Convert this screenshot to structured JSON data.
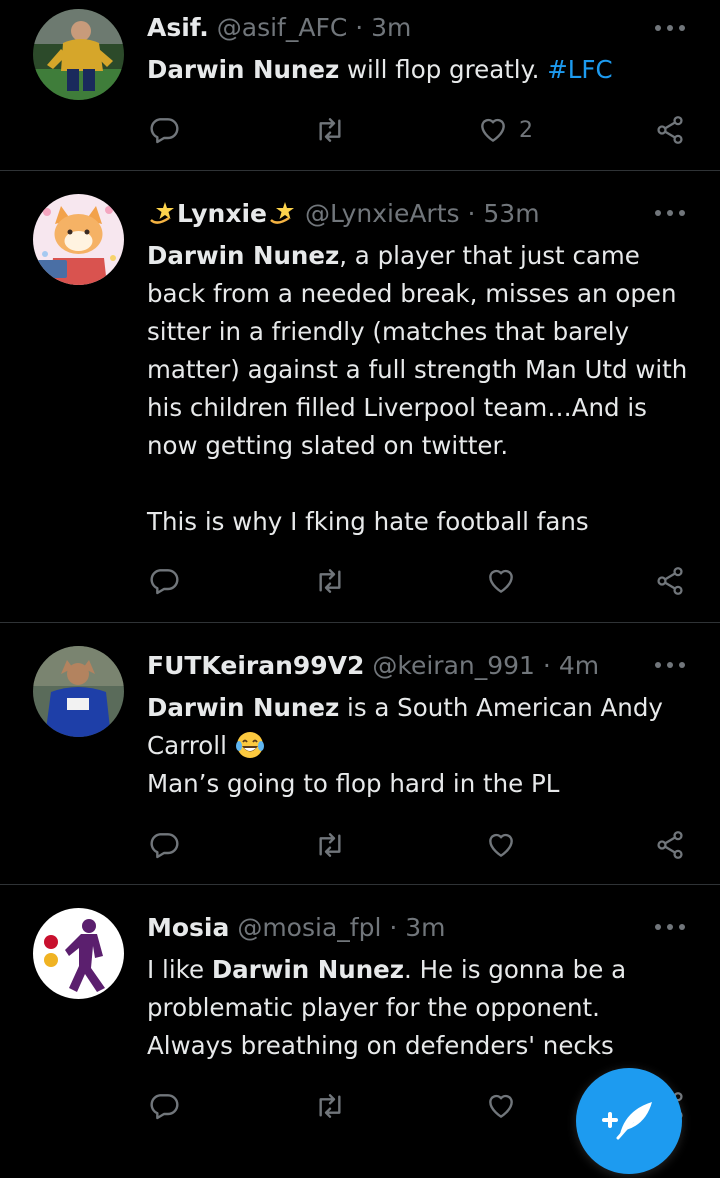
{
  "colors": {
    "background": "#000000",
    "text": "#e7e9ea",
    "muted": "#71767b",
    "accent": "#1d9bf0",
    "divider": "#2f3336"
  },
  "icons": {
    "reply": "reply-icon",
    "retweet": "retweet-icon",
    "like": "heart-icon",
    "share": "share-icon",
    "more": "more-icon",
    "compose": "compose-feather-icon"
  },
  "tweets": [
    {
      "name": "Asif.",
      "handle": "@asif_AFC",
      "separator": "·",
      "time": "3m",
      "text_bold": "Darwin Nunez",
      "text_rest": " will flop greatly. ",
      "hashtag": "#LFC",
      "like_count": "2"
    },
    {
      "name": "Lynxie",
      "handle": "@LynxieArts",
      "separator": "·",
      "time": "53m",
      "text_bold": "Darwin Nunez",
      "text_rest": ", a player that just came back from a needed break, misses an open sitter in a friendly (matches that barely matter) against a full strength Man Utd with his children filled Liverpool team…And is now getting slated on twitter.",
      "text_second": "This is why I fking hate football fans"
    },
    {
      "name": "FUTKeiran99V2",
      "handle": "@keiran_991",
      "separator": "·",
      "time": "4m",
      "text_bold": "Darwin Nunez",
      "text_rest": " is a South American Andy Carroll ",
      "emoji": "face-with-tears-of-joy",
      "text_second": "Man’s going to flop hard in the PL"
    },
    {
      "name": "Mosia",
      "handle": "@mosia_fpl",
      "separator": "·",
      "time": "3m",
      "text_pre": "I like ",
      "text_bold": "Darwin Nunez",
      "text_rest": ". He is gonna be a problematic player for the opponent. Always breathing on defenders' necks"
    }
  ]
}
